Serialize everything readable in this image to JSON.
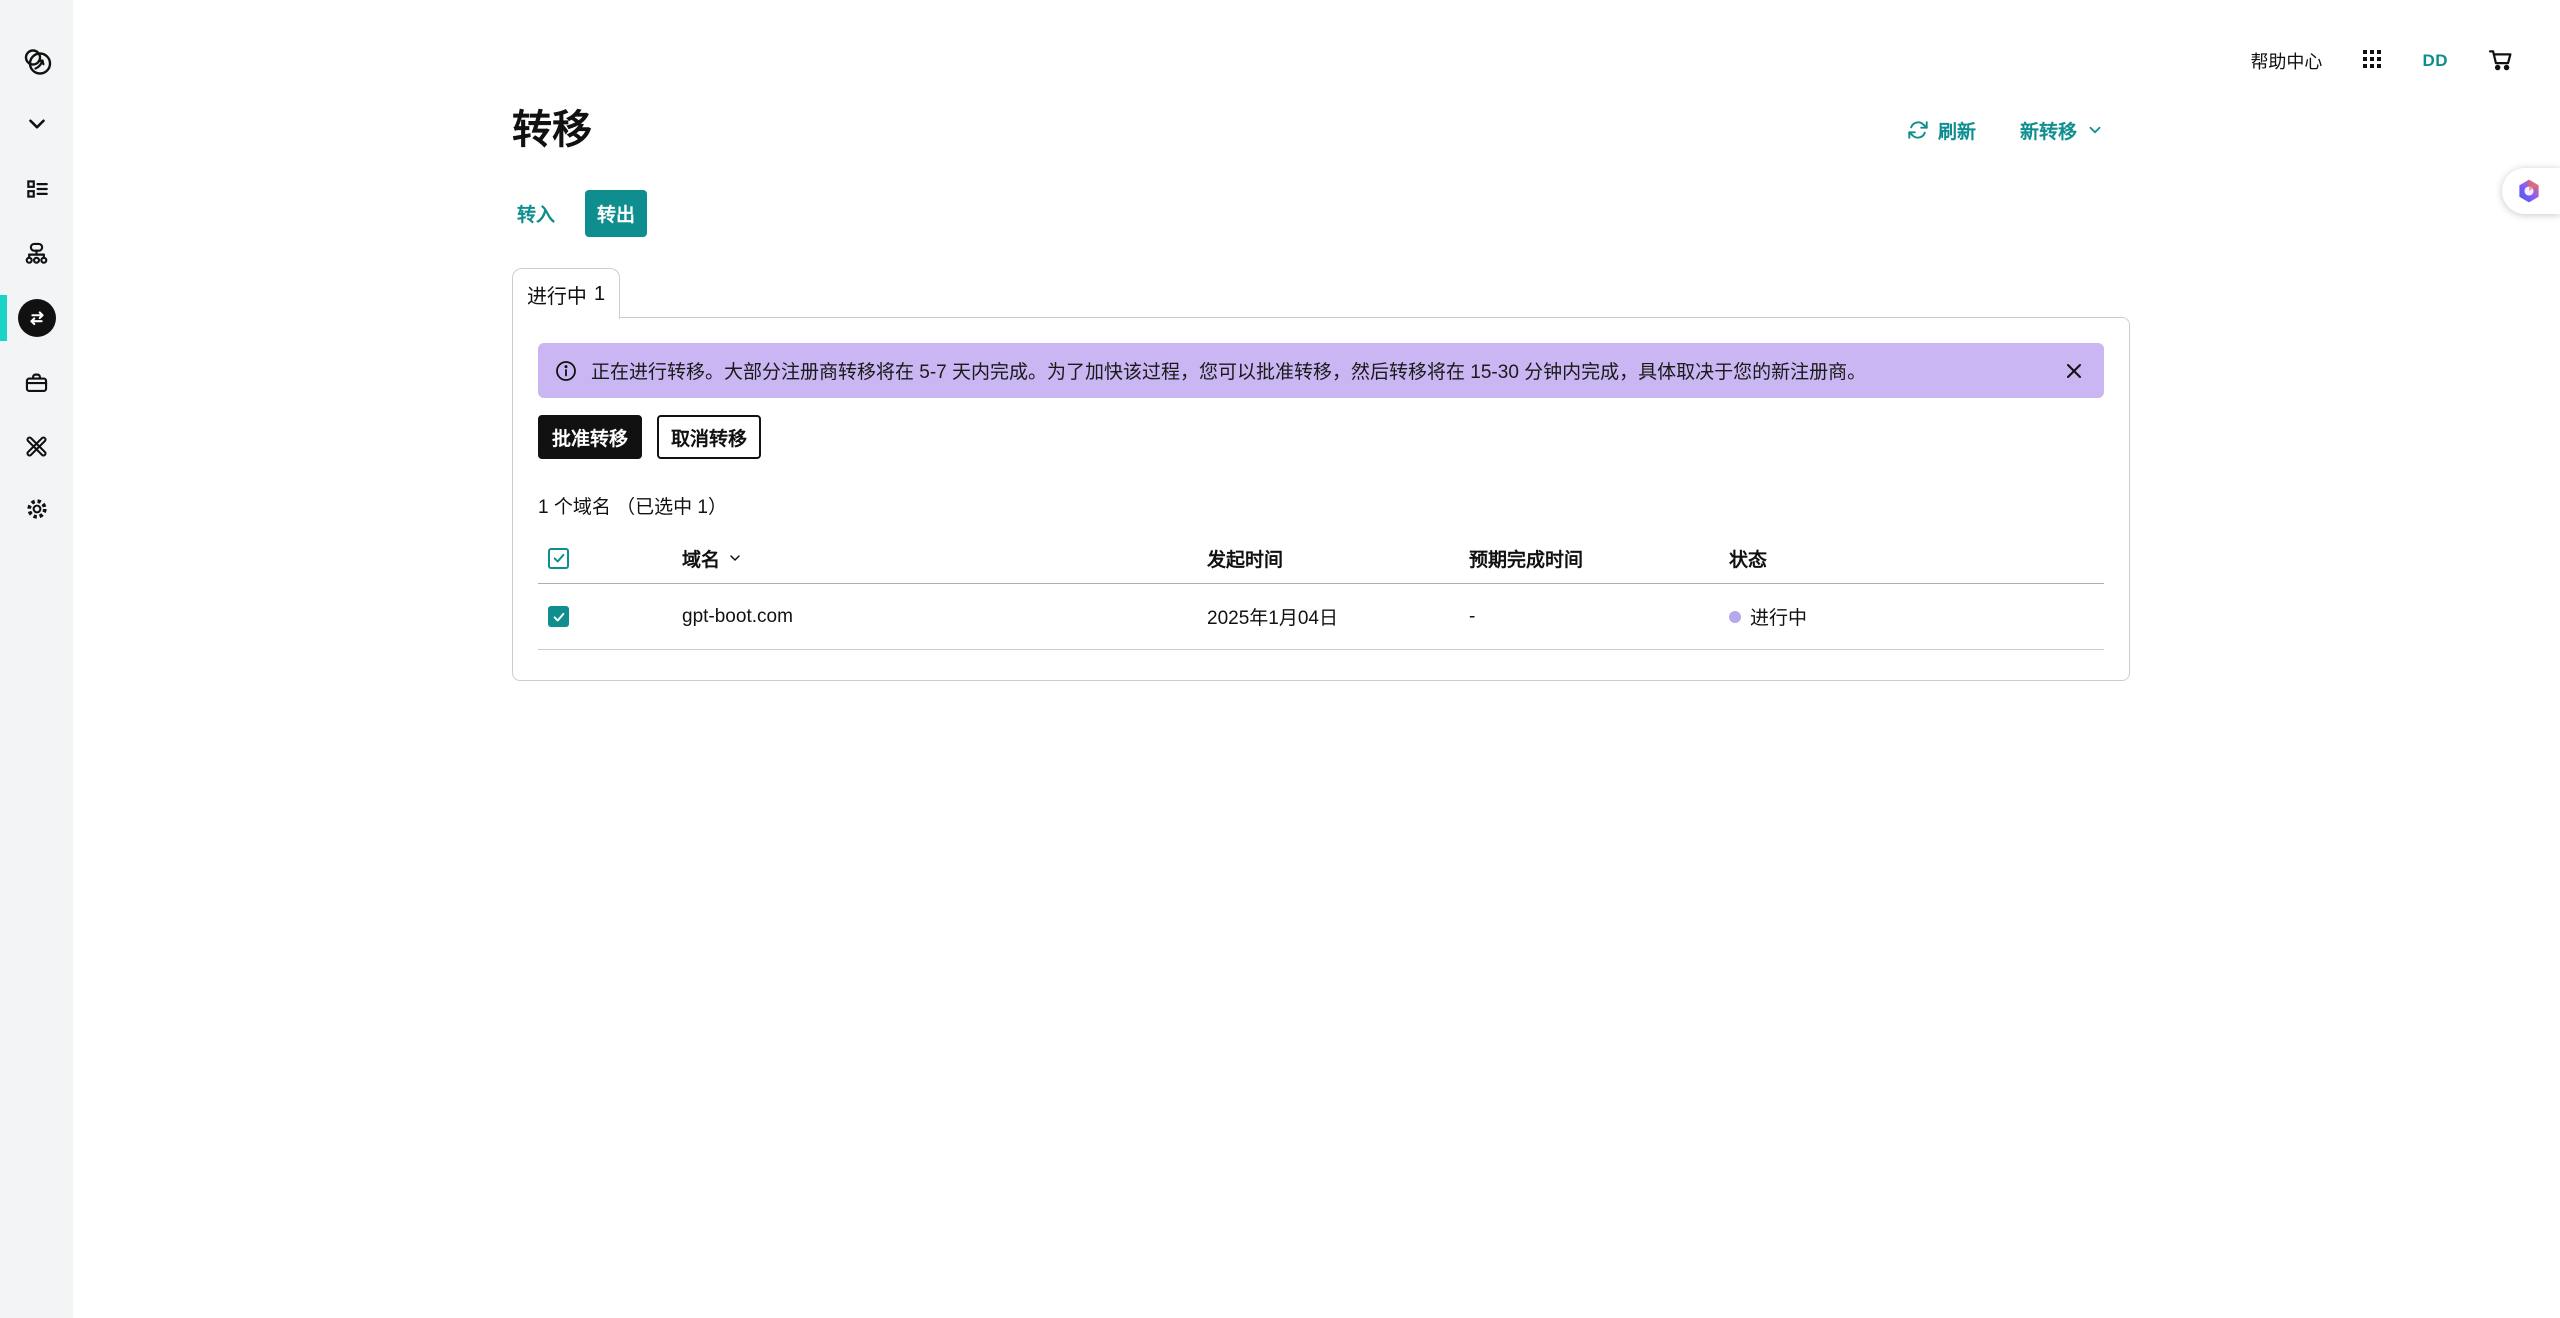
{
  "topbar": {
    "help_center": "帮助中心",
    "avatar_initials": "DD"
  },
  "sidebar": {
    "icons": [
      "godaddy-logo",
      "chevron-down",
      "domain-list",
      "dns-tree",
      "transfers",
      "business",
      "design-tools",
      "settings"
    ],
    "active_item": "transfers"
  },
  "page": {
    "title": "转移"
  },
  "toolbar": {
    "refresh_label": "刷新",
    "new_transfer_label": "新转移"
  },
  "view_tabs": {
    "transfer_in": "转入",
    "transfer_out": "转出",
    "active": "转出"
  },
  "status_tab": {
    "label": "进行中",
    "count": "1"
  },
  "alert": {
    "message": "正在进行转移。大部分注册商转移将在 5-7 天内完成。为了加快该过程，您可以批准转移，然后转移将在 15-30 分钟内完成，具体取决于您的新注册商。"
  },
  "actions": {
    "approve": "批准转移",
    "cancel": "取消转移"
  },
  "selection_summary": "1 个域名 （已选中 1）",
  "table": {
    "headers": {
      "domain": "域名",
      "initiated": "发起时间",
      "expected_completion": "预期完成时间",
      "status": "状态"
    },
    "rows": [
      {
        "selected": true,
        "domain": "gpt-boot.com",
        "initiated": "2025年1月04日",
        "expected_completion": "-",
        "status": "进行中"
      }
    ]
  },
  "colors": {
    "accent_teal": "#0e8e8e",
    "active_indicator": "#1bd4c5",
    "alert_purple": "#c9b6f2",
    "status_dot_purple": "#b7a7ec",
    "sidebar_bg": "#f2f4f5",
    "border_gray": "#cbcdcf",
    "text": "#111111"
  }
}
